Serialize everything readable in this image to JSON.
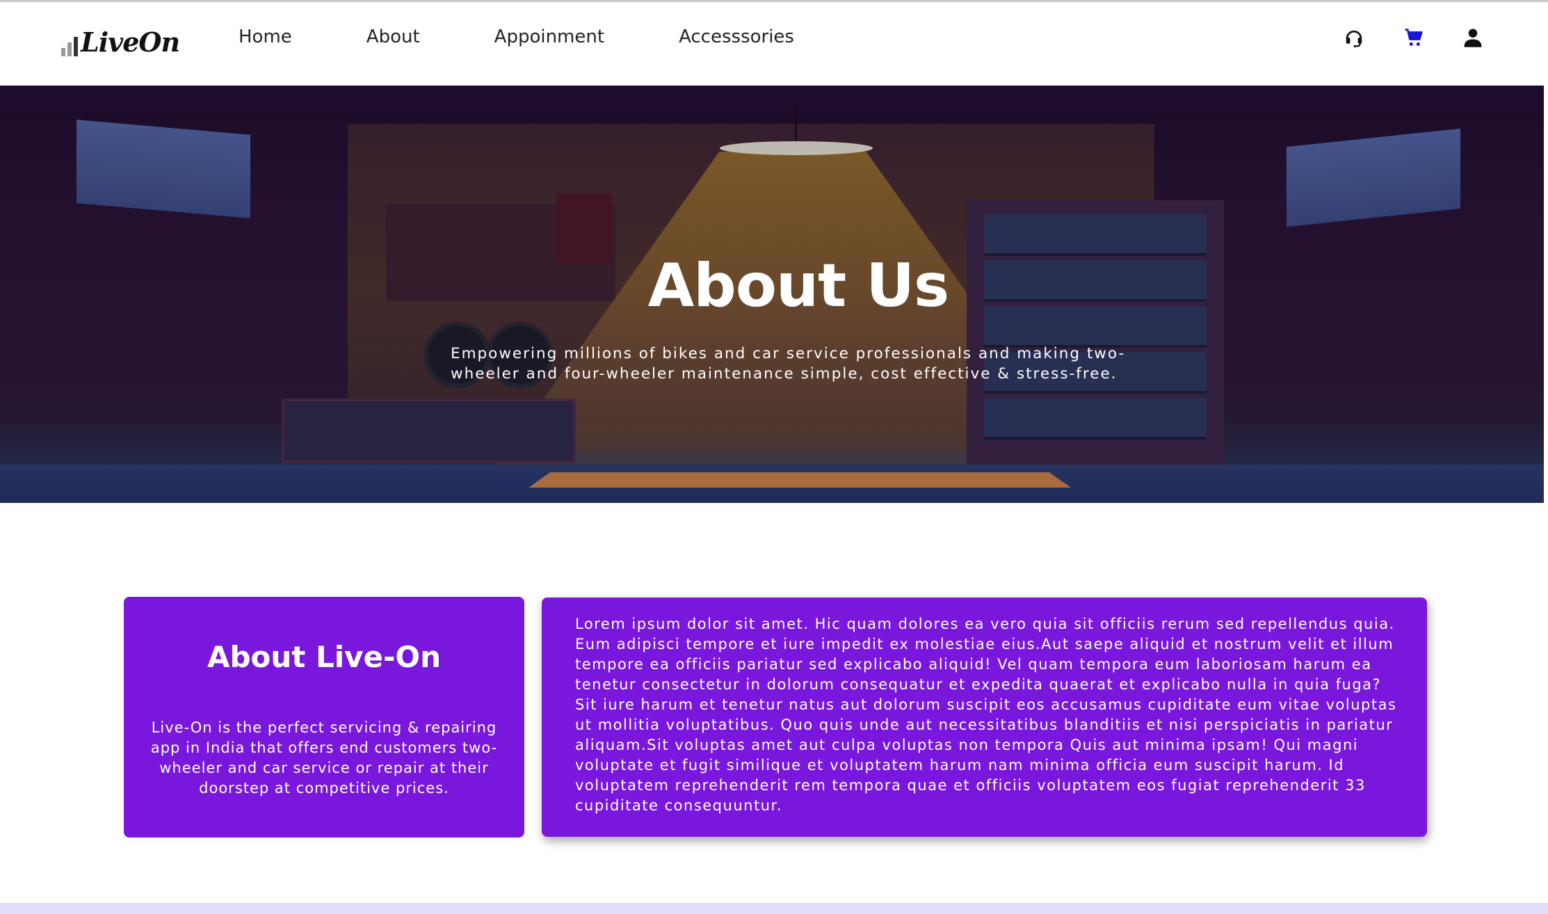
{
  "brand": {
    "logo_text": "LiveOn"
  },
  "nav": {
    "links": [
      "Home",
      "About",
      "Appoinment",
      "Accesssories"
    ],
    "icons": [
      "headset-icon",
      "cart-icon",
      "user-icon"
    ],
    "cart_icon_color": "#1a14d6"
  },
  "hero": {
    "title": "About Us",
    "subtitle": "Empowering millions of bikes and car service professionals and making two-wheeler and four-wheeler maintenance simple, cost effective & stress-free."
  },
  "about_card": {
    "title": "About Live-On",
    "text": "Live-On is the perfect servicing & repairing app in India that offers end customers two-wheeler and car service or repair at their doorstep at competitive prices."
  },
  "detail_card": {
    "text": "Lorem ipsum dolor sit amet. Hic quam dolores ea vero quia sit officiis rerum sed repellendus quia. Eum adipisci tempore et iure impedit ex molestiae eius.Aut saepe aliquid et nostrum velit et illum tempore ea officiis pariatur sed explicabo aliquid! Vel quam tempora eum laboriosam harum ea tenetur consectetur in dolorum consequatur et expedita quaerat et explicabo nulla in quia fuga? Sit iure harum et tenetur natus aut dolorum suscipit eos accusamus cupiditate eum vitae voluptas ut mollitia voluptatibus. Quo quis unde aut necessitatibus blanditiis et nisi perspiciatis in pariatur aliquam.Sit voluptas amet aut culpa voluptas non tempora Quis aut minima ipsam! Qui magni voluptate et fugit similique et voluptatem harum nam minima officia eum suscipit harum. Id voluptatem reprehenderit rem tempora quae et officiis voluptatem eos fugiat reprehenderit 33 cupiditate consequuntur."
  },
  "colors": {
    "accent": "#7917dd",
    "footer_strip": "#e4dcfb"
  }
}
